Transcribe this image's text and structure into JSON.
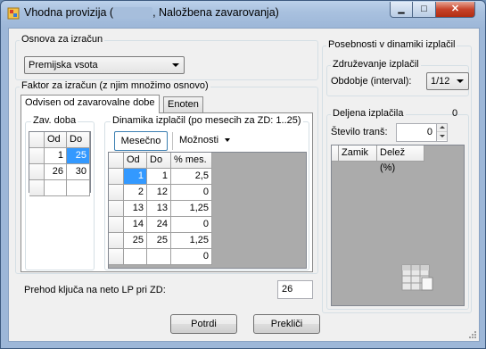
{
  "window": {
    "title_prefix": "Vhodna provizija (",
    "title_suffix": ", Naložbena zavarovanja)",
    "min_glyph": "▁",
    "max_glyph": "□",
    "close_glyph": "✕"
  },
  "left": {
    "osnova_title": "Osnova za izračun",
    "osnova_value": "Premijska vsota",
    "faktor_title": "Faktor za izračun (z njim množimo osnovo)",
    "tabs": [
      "Odvisen od zavarovalne dobe",
      "Enoten"
    ],
    "zav_doba_title": "Zav. doba",
    "zav_doba_headers": [
      "Od",
      "Do"
    ],
    "zav_doba_rows": [
      [
        "1",
        "25"
      ],
      [
        "26",
        "30"
      ]
    ],
    "dinamika_title": "Dinamika izplačil (po mesecih za ZD: 1..25)",
    "toolbar_mesecno": "Mesečno",
    "toolbar_moznosti": "Možnosti",
    "dinamika_headers": [
      "Od",
      "Do",
      "% mes."
    ],
    "dinamika_rows": [
      [
        "1",
        "1",
        "2,5"
      ],
      [
        "2",
        "12",
        "0"
      ],
      [
        "13",
        "13",
        "1,25"
      ],
      [
        "14",
        "24",
        "0"
      ],
      [
        "25",
        "25",
        "1,25"
      ],
      [
        "",
        "",
        "0"
      ]
    ],
    "prehod_label": "Prehod ključa na neto LP pri ZD:",
    "prehod_value": "26"
  },
  "right": {
    "posebnosti_title": "Posebnosti v dinamiki izplačil",
    "zdruzevanje_title": "Združevanje izplačil",
    "obdobje_label": "Obdobje (interval):",
    "obdobje_value": "1/12",
    "deljena_title": "Deljena izplačila",
    "deljena_count": "0",
    "stevilo_label": "Število tranš:",
    "stevilo_value": "0",
    "transe_headers": [
      "Zamik",
      "Delež (%)"
    ]
  },
  "buttons": {
    "ok": "Potrdi",
    "cancel": "Prekliči"
  },
  "colors": {
    "selection": "#3399ff",
    "grid_background": "#ababab",
    "close_red": "#c7432a"
  }
}
